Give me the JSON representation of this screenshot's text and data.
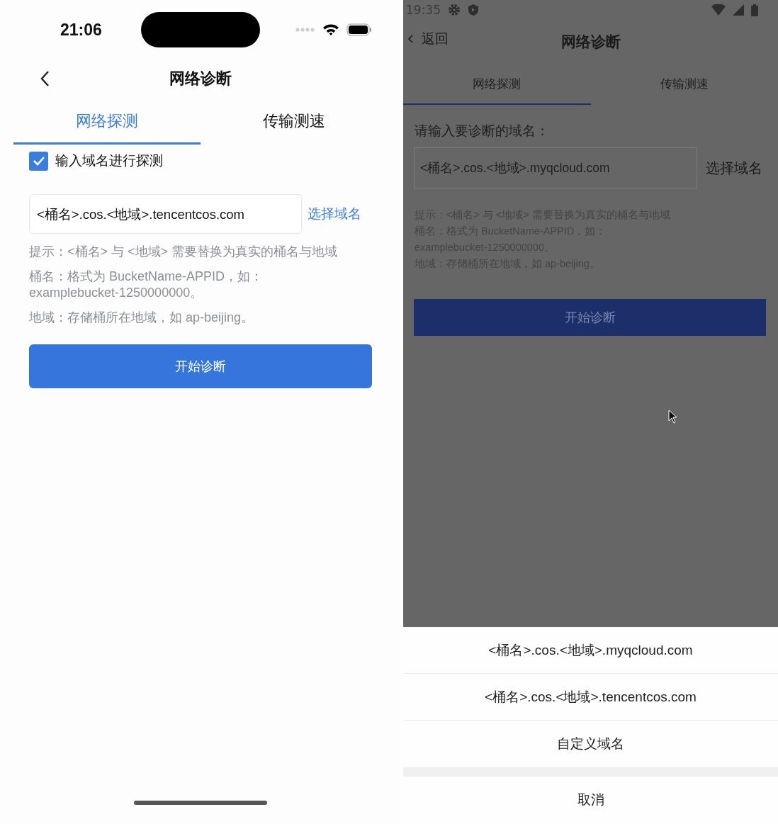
{
  "ios_screen": {
    "status_bar": {
      "time": "21:06"
    },
    "nav": {
      "title": "网络诊断"
    },
    "tabs": [
      {
        "label": "网络探测",
        "selected": true
      },
      {
        "label": "传输测速",
        "selected": false
      }
    ],
    "probe_checkbox": {
      "label": "输入域名进行探测",
      "checked": true
    },
    "domain_field": {
      "value": "<桶名>.cos.<地域>.tencentcos.com"
    },
    "select_link": "选择域名",
    "hints": [
      [
        "提示：<桶名> 与 <地域> 需要替换为真实的桶名与地域"
      ],
      [
        "桶名：格式为 BucketName-APPID，如：",
        "examplebucket-1250000000。"
      ],
      [
        "地域：存储桶所在地域，如 ap-beijing。"
      ]
    ],
    "start_button": "开始诊断"
  },
  "android_screen": {
    "status_bar": {
      "time": "19:35"
    },
    "nav": {
      "back": "返回",
      "title": "网络诊断"
    },
    "tabs": [
      {
        "label": "网络探测",
        "selected": true
      },
      {
        "label": "传输测速",
        "selected": false
      }
    ],
    "prompt": "请输入要诊断的域名：",
    "domain_field": {
      "value": "<桶名>.cos.<地域>.myqcloud.com"
    },
    "select_button": "选择域名",
    "hints": [
      "提示：<桶名> 与 <地域> 需要替换为真实的桶名与地域",
      "桶名：格式为 BucketName-APPID，如：",
      "examplebucket-1250000000。",
      "地域：存储桶所在地域，如 ap-beijing。"
    ],
    "start_button": "开始诊断",
    "action_sheet": {
      "options": [
        "<桶名>.cos.<地域>.myqcloud.com",
        "<桶名>.cos.<地域>.tencentcos.com",
        "自定义域名"
      ],
      "cancel": "取消"
    }
  }
}
